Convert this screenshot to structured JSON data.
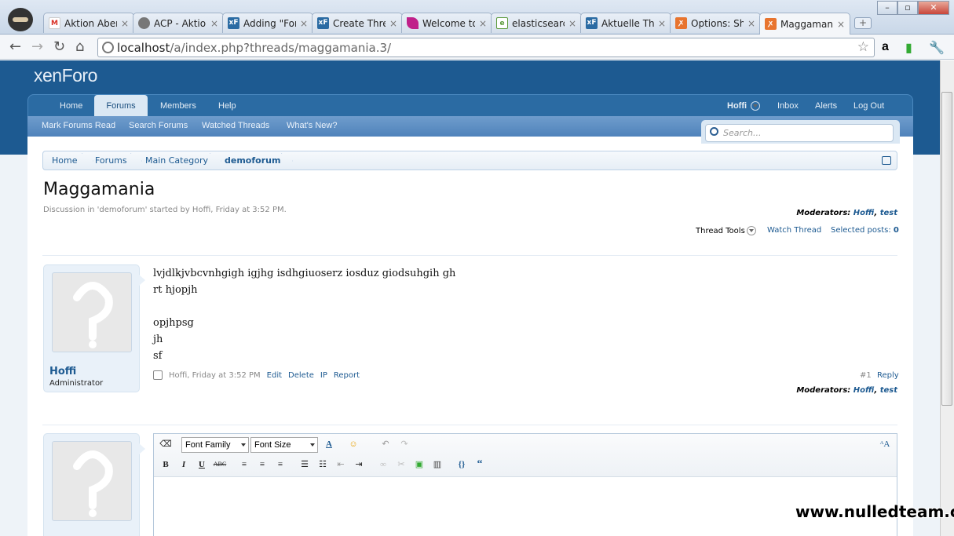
{
  "browser": {
    "tabs": [
      {
        "label": "Aktion Aben",
        "icon": "gmail-icon",
        "color": "#d93025"
      },
      {
        "label": "ACP - Aktior",
        "icon": "globe-icon",
        "color": "#777777"
      },
      {
        "label": "Adding \"For",
        "icon": "xenforo-icon",
        "color": "#2b6ba3"
      },
      {
        "label": "Create Threa",
        "icon": "xenforo-icon",
        "color": "#2b6ba3"
      },
      {
        "label": "Welcome to",
        "icon": "feather-icon",
        "color": "#c0208a"
      },
      {
        "label": "elasticsearch",
        "icon": "elastic-icon",
        "color": "#5a9a3a"
      },
      {
        "label": "Aktuelle The",
        "icon": "xenforo-icon",
        "color": "#2b6ba3"
      },
      {
        "label": "Options: Sho",
        "icon": "xampp-icon",
        "color": "#e8742e"
      },
      {
        "label": "Maggamani",
        "icon": "xampp-icon",
        "color": "#e8742e"
      }
    ],
    "url_host": "localhost",
    "url_path": "/a/index.php?threads/maggamania.3/"
  },
  "site": {
    "logo": "xenForo",
    "nav": [
      "Home",
      "Forums",
      "Members",
      "Help"
    ],
    "nav_active": "Forums",
    "user": "Hoffi",
    "user_links": [
      "Inbox",
      "Alerts",
      "Log Out"
    ],
    "subnav": [
      "Mark Forums Read",
      "Search Forums",
      "Watched Threads",
      "What's New?"
    ],
    "search_placeholder": "Search..."
  },
  "breadcrumb": [
    "Home",
    "Forums",
    "Main Category",
    "demoforum"
  ],
  "thread": {
    "title": "Maggamania",
    "meta": "Discussion in 'demoforum' started by Hoffi, Friday at 3:52 PM.",
    "moderators_label": "Moderators:",
    "moderators": "Hoffi",
    "moderators_sep": ", ",
    "moderators2": "test",
    "thread_tools": "Thread Tools",
    "watch": "Watch Thread",
    "selected_label": "Selected posts:",
    "selected_count": "0"
  },
  "post": {
    "author": "Hoffi",
    "author_title": "Administrator",
    "body": "lvjdlkjvbcvnhgigh igjhg isdhgiuoserz iosduz giodsuhgih gh\nrt hjopjh\n\nopjhpsg\njh\nsf",
    "timestamp": "Hoffi, Friday at 3:52 PM",
    "actions": [
      "Edit",
      "Delete",
      "IP",
      "Report"
    ],
    "number": "#1",
    "reply": "Reply"
  },
  "editor": {
    "font_family": "Font Family",
    "font_size": "Font Size"
  },
  "watermark": "www.nulledteam.com"
}
